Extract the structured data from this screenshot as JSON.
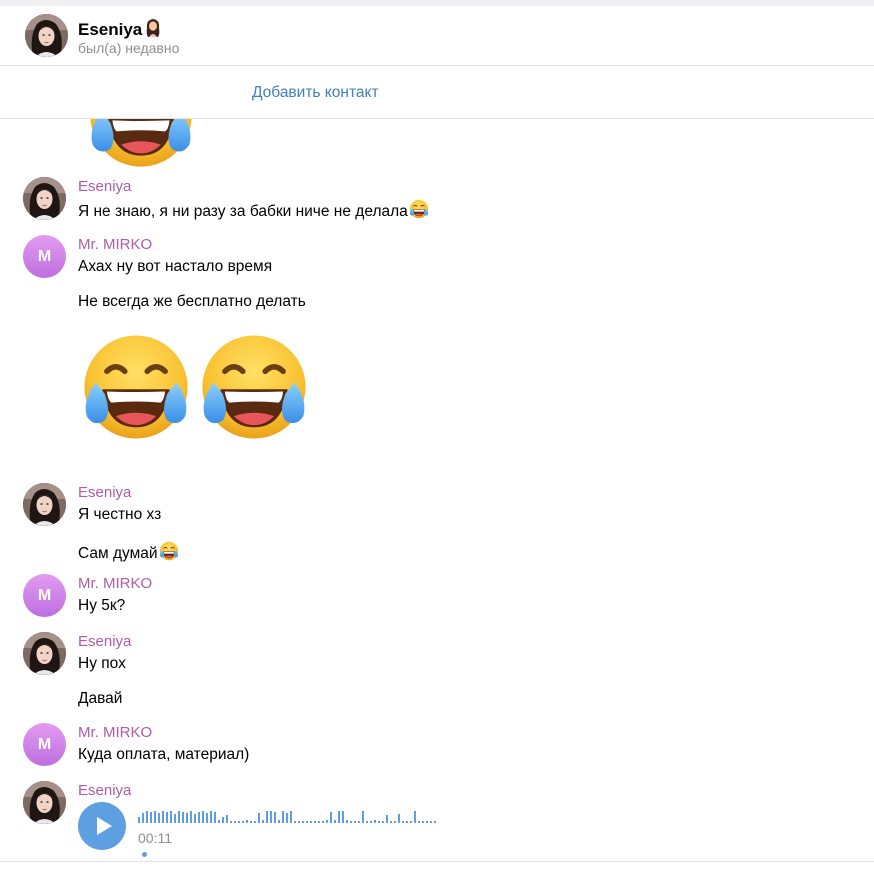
{
  "header": {
    "title": "Eseniya",
    "title_emoji": "girl-emoji",
    "status": "был(а) недавно"
  },
  "add_contact": "Добавить контакт",
  "chat": {
    "m1": {
      "sender": "Eseniya",
      "text": "Я не знаю, я ни разу за бабки ниче не делала"
    },
    "m2": {
      "sender": "Mr. MIRKO",
      "initial": "M",
      "line1": "Ахах ну вот настало время",
      "line2": "Не всегда же бесплатно делать"
    },
    "m3": {
      "sender": "Eseniya",
      "line1": "Я честно хз",
      "line2": "Сам думай"
    },
    "m4": {
      "sender": "Mr. MIRKO",
      "initial": "M",
      "text": "Ну 5к?"
    },
    "m5": {
      "sender": "Eseniya",
      "line1": "Ну пох",
      "line2": "Давай"
    },
    "m6": {
      "sender": "Mr. MIRKO",
      "initial": "M",
      "text": "Куда оплата, материал)"
    },
    "m7": {
      "sender": "Eseniya",
      "voice_duration": "00:11"
    }
  },
  "colors": {
    "sender_name": "#b05ba6",
    "link": "#3f80b8",
    "voice_accent": "#5d9fe0",
    "avatar_gradient_top": "#e39bf0",
    "avatar_gradient_bottom": "#bd6fe0",
    "muted_text": "#8e8e93"
  },
  "icons": [
    "tears-of-joy-emoji",
    "play-icon",
    "waveform"
  ]
}
